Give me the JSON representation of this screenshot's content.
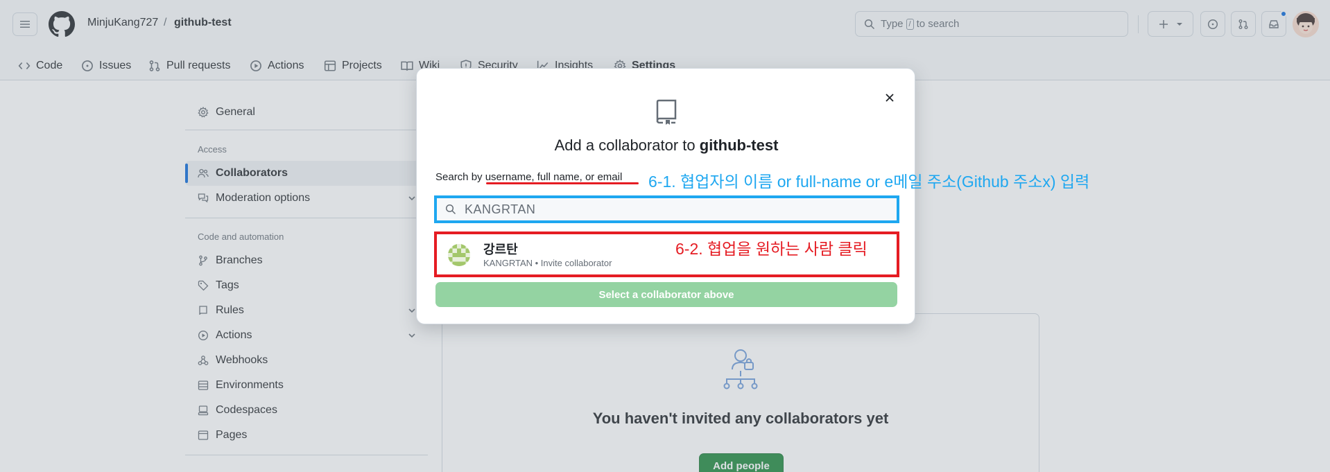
{
  "header": {
    "owner": "MinjuKang727",
    "separator": "/",
    "repo": "github-test",
    "search_prefix": "Type",
    "search_key": "/",
    "search_suffix": "to search"
  },
  "tabs": [
    {
      "label": "Code",
      "icon": "code-icon"
    },
    {
      "label": "Issues",
      "icon": "issue-icon"
    },
    {
      "label": "Pull requests",
      "icon": "pull-request-icon"
    },
    {
      "label": "Actions",
      "icon": "play-icon"
    },
    {
      "label": "Projects",
      "icon": "table-icon"
    },
    {
      "label": "Wiki",
      "icon": "book-icon"
    },
    {
      "label": "Security",
      "icon": "shield-icon"
    },
    {
      "label": "Insights",
      "icon": "graph-icon"
    },
    {
      "label": "Settings",
      "icon": "gear-icon",
      "selected": true
    }
  ],
  "sidebar": {
    "general": "General",
    "access_heading": "Access",
    "collaborators": "Collaborators",
    "moderation": "Moderation options",
    "code_heading": "Code and automation",
    "branches": "Branches",
    "tags": "Tags",
    "rules": "Rules",
    "actions": "Actions",
    "webhooks": "Webhooks",
    "environments": "Environments",
    "codespaces": "Codespaces",
    "pages": "Pages"
  },
  "main": {
    "empty_text": "You haven't invited any collaborators yet",
    "add_people": "Add people"
  },
  "modal": {
    "title_prefix": "Add a collaborator to",
    "title_repo": "github-test",
    "search_label_prefix": "Search by",
    "search_label_em": "username, full name, or email",
    "input_value": "KANGRTAN",
    "result_name": "강르탄",
    "result_sub": "KANGRTAN  • Invite collaborator",
    "select_button": "Select a collaborator above"
  },
  "annotations": {
    "step1": "6-1. 협업자의 이름 or full-name or e메일 주소(Github 주소x) 입력",
    "step2": "6-2. 협업을 원하는 사람 클릭"
  },
  "colors": {
    "accent_blue": "#1ea7f0",
    "annotation_red": "#e51c23",
    "primary_green": "#1f883d",
    "disabled_green": "#94d3a2",
    "tab_underline": "#fd8c73"
  }
}
